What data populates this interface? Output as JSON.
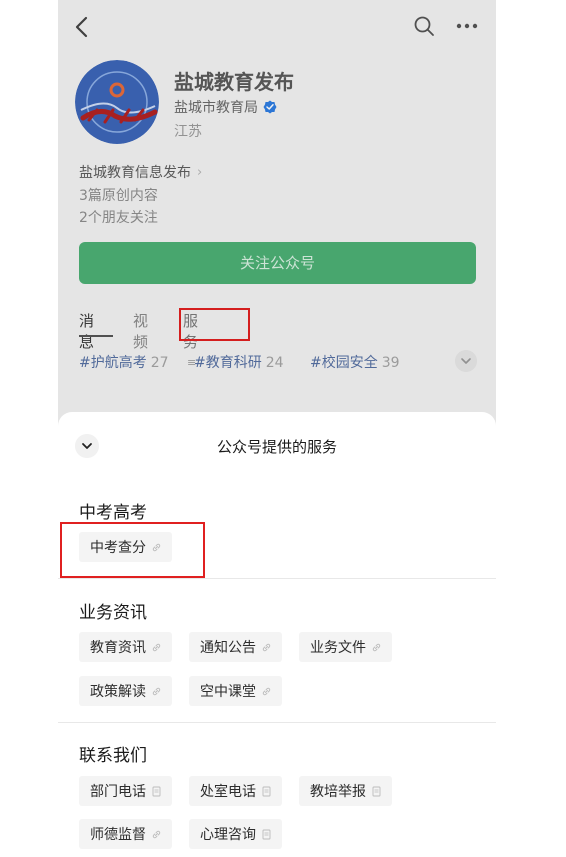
{
  "profile": {
    "account_name": "盐城教育发布",
    "owner": "盐城市教育局",
    "region": "江苏",
    "description": "盐城教育信息发布",
    "description_chevron": "›",
    "stat_original": "3篇原创内容",
    "stat_friends": "2个朋友关注",
    "follow_button": "关注公众号"
  },
  "tabs": [
    {
      "label": "消息"
    },
    {
      "label": "视频"
    },
    {
      "label": "服务",
      "icon": "≡"
    }
  ],
  "tags": [
    {
      "name": "#护航高考",
      "count": "27"
    },
    {
      "name": "#教育科研",
      "count": "24"
    },
    {
      "name": "#校园安全",
      "count": "39"
    }
  ],
  "sheet": {
    "title": "公众号提供的服务",
    "sections": [
      {
        "title": "中考高考",
        "items": [
          {
            "label": "中考查分",
            "icon": "link"
          }
        ]
      },
      {
        "title": "业务资讯",
        "items": [
          {
            "label": "教育资讯",
            "icon": "link"
          },
          {
            "label": "通知公告",
            "icon": "link"
          },
          {
            "label": "业务文件",
            "icon": "link"
          },
          {
            "label": "政策解读",
            "icon": "link"
          },
          {
            "label": "空中课堂",
            "icon": "link"
          }
        ]
      },
      {
        "title": "联系我们",
        "items": [
          {
            "label": "部门电话",
            "icon": "doc"
          },
          {
            "label": "处室电话",
            "icon": "doc"
          },
          {
            "label": "教培举报",
            "icon": "doc"
          },
          {
            "label": "师德监督",
            "icon": "link"
          },
          {
            "label": "心理咨询",
            "icon": "doc"
          }
        ]
      }
    ]
  },
  "colors": {
    "follow_green": "#4caf74",
    "tag_blue": "#5670a3",
    "highlight_red": "#e02020",
    "verified_blue": "#2f7de1"
  }
}
